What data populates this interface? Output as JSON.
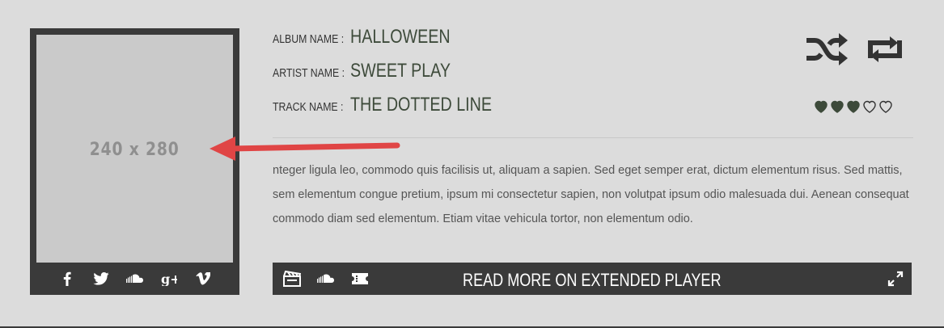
{
  "album_card": {
    "art_placeholder": "240 x 280",
    "social_icons": [
      "facebook-icon",
      "twitter-icon",
      "soundcloud-icon",
      "google-plus-icon",
      "vimeo-icon"
    ]
  },
  "track_info": {
    "album_label": "ALBUM NAME :",
    "album_value": "HALLOWEEN",
    "artist_label": "ARTIST NAME :",
    "artist_value": "SWEET PLAY",
    "track_label": "TRACK NAME :",
    "track_value": "THE DOTTED LINE"
  },
  "controls": {
    "icons": [
      "shuffle-icon",
      "repeat-icon"
    ],
    "rating": {
      "filled": 3,
      "total": 5
    }
  },
  "description": "nteger ligula leo, commodo quis facilisis ut, aliquam a sapien. Sed eget semper erat, dictum elementum risus. Sed mattis, sem elementum congue pretium, ipsum mi consectetur sapien, non volutpat ipsum odio malesuada dui. Aenean consequat commodo diam sed elementum. Etiam vitae vehicula tortor, non elementum odio.",
  "player_bar": {
    "icons": [
      "clapperboard-icon",
      "soundcloud-icon",
      "ticket-icon"
    ],
    "title": "READ MORE ON EXTENDED PLAYER",
    "expand_icon": "expand-icon"
  },
  "colors": {
    "background": "#dcdcdc",
    "dark": "#3a3a3a",
    "accent_green": "#3d4a3a",
    "arrow_red": "#e04545"
  }
}
